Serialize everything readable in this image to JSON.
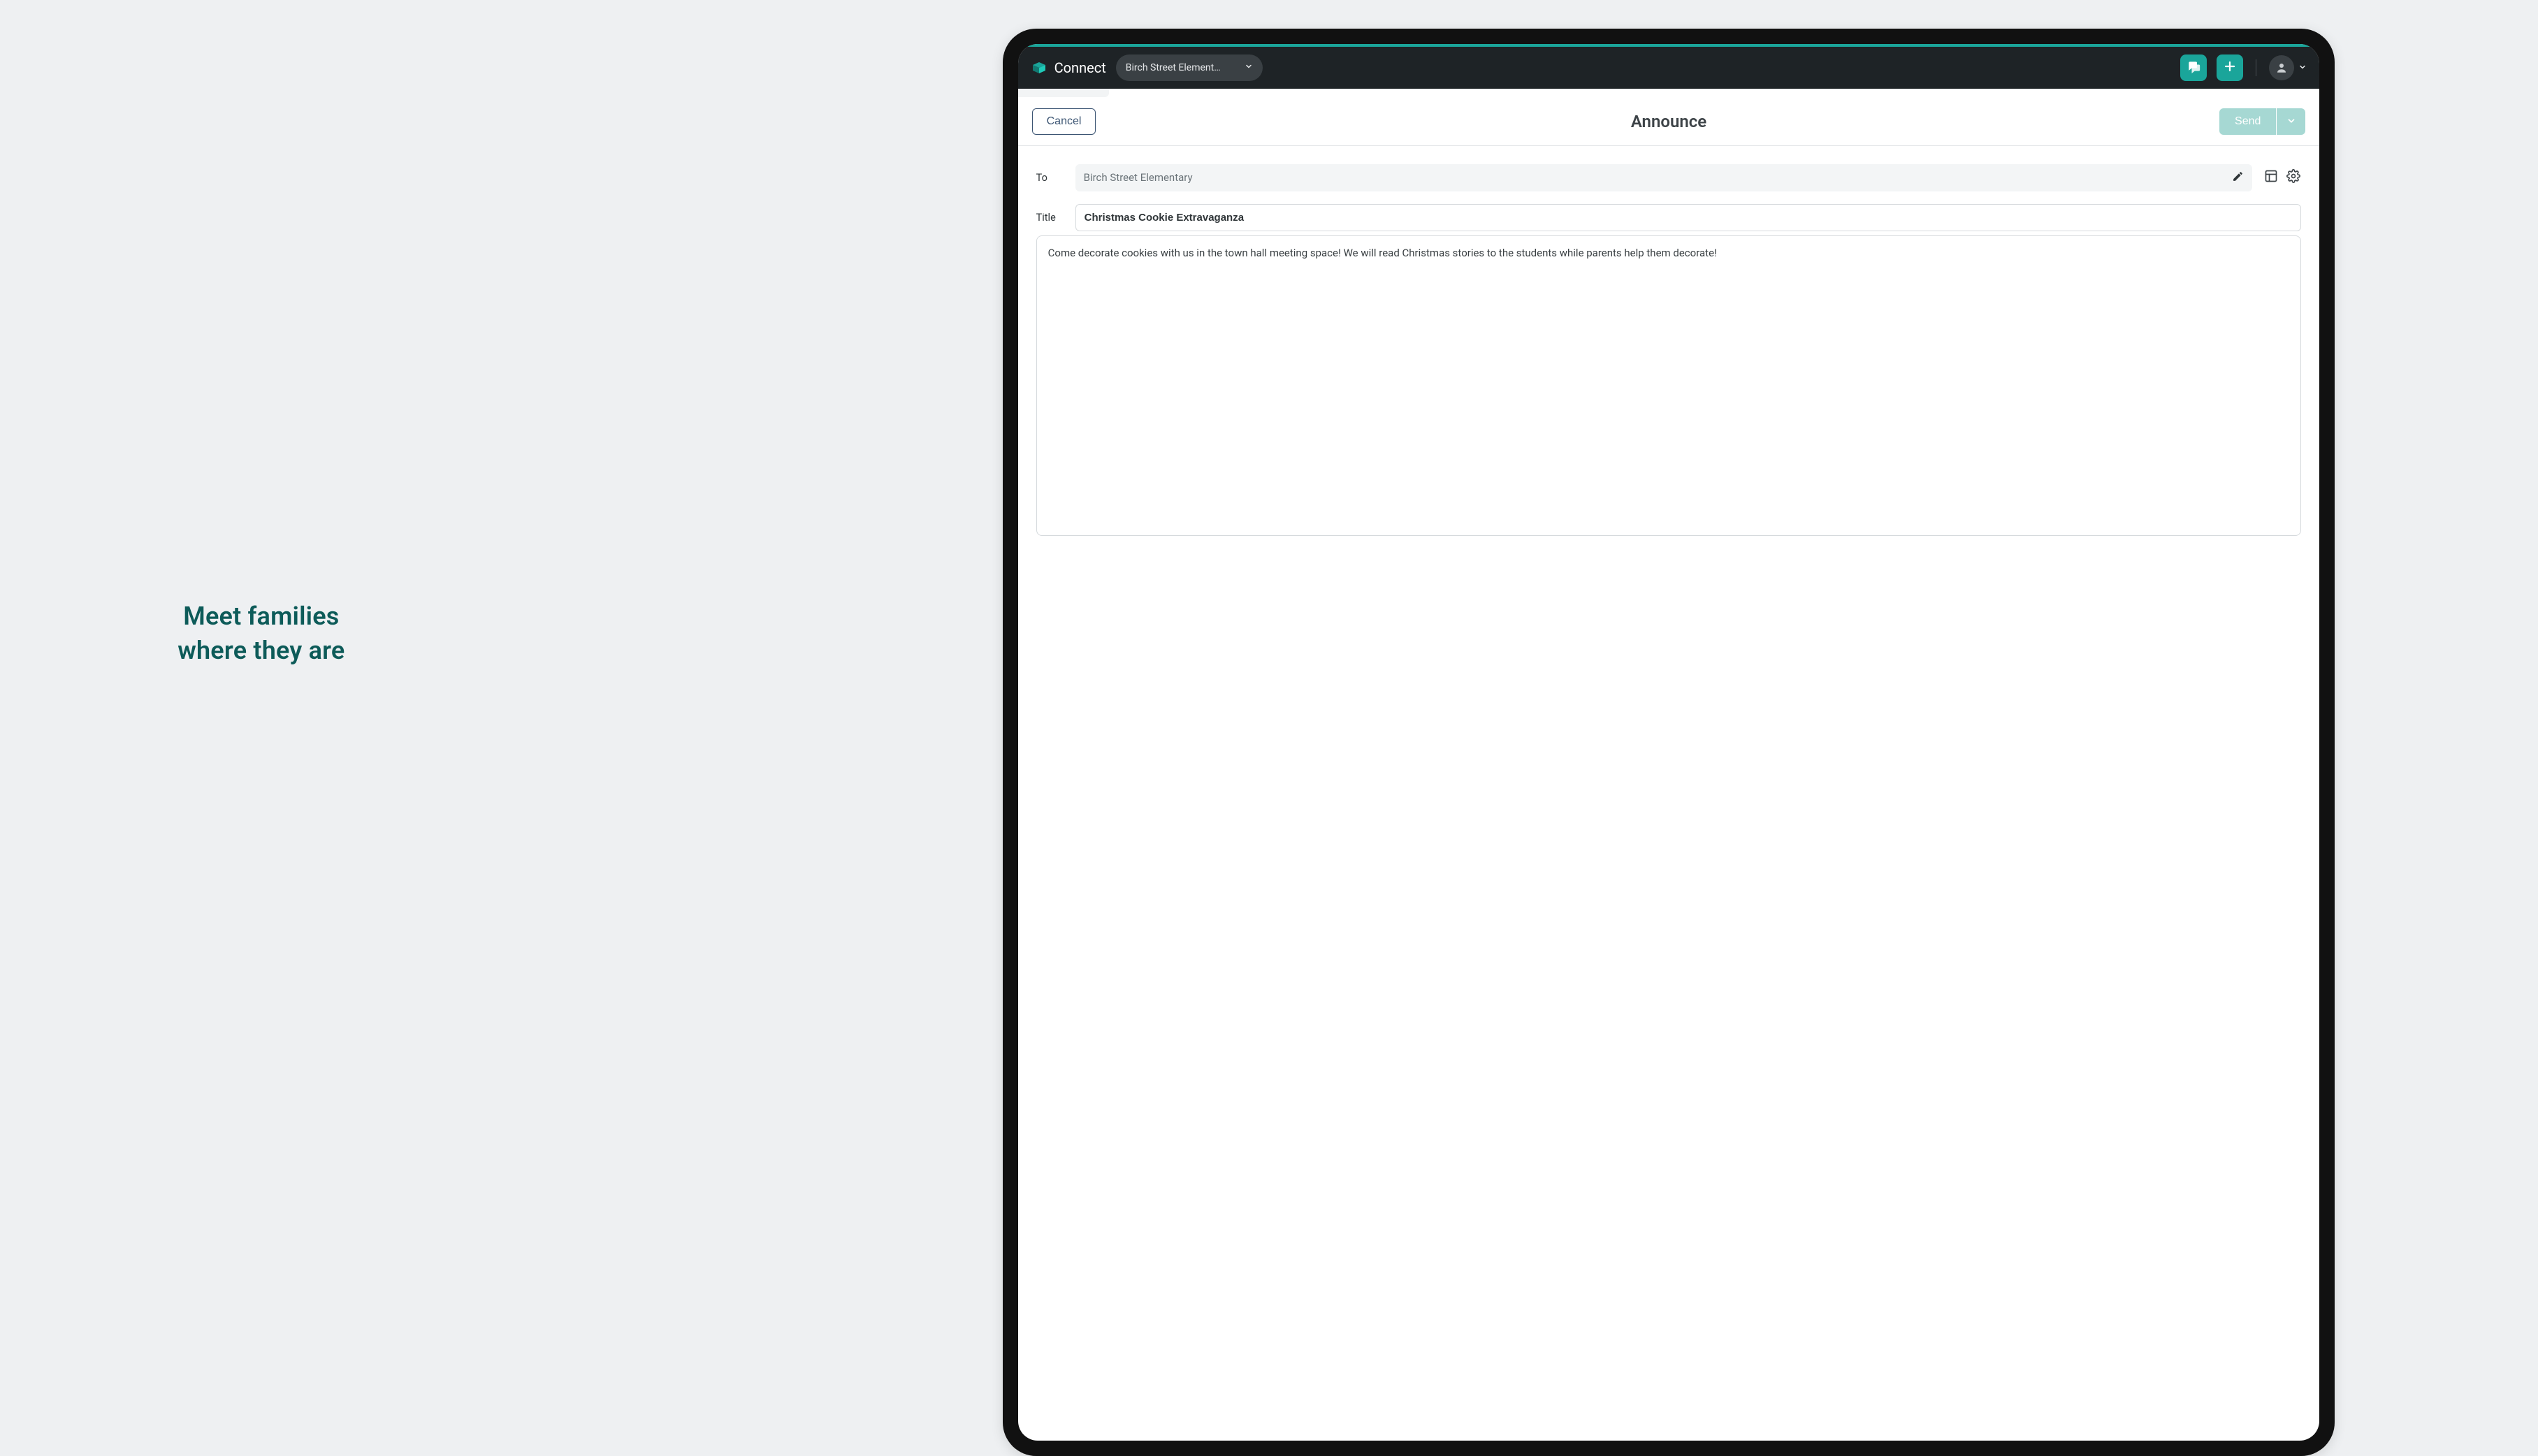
{
  "marketing": {
    "tagline": "Meet families\nwhere they are"
  },
  "app": {
    "name": "Connect",
    "school_selector": "Birch Street Element…"
  },
  "compose": {
    "cancel_label": "Cancel",
    "page_title": "Announce",
    "send_label": "Send",
    "to_label": "To",
    "to_value": "Birch Street Elementary",
    "title_label": "Title",
    "title_value": "Christmas Cookie Extravaganza",
    "body_text": "Come decorate cookies with us in the town hall meeting space! We will read Christmas stories to the students while parents help them decorate!"
  }
}
